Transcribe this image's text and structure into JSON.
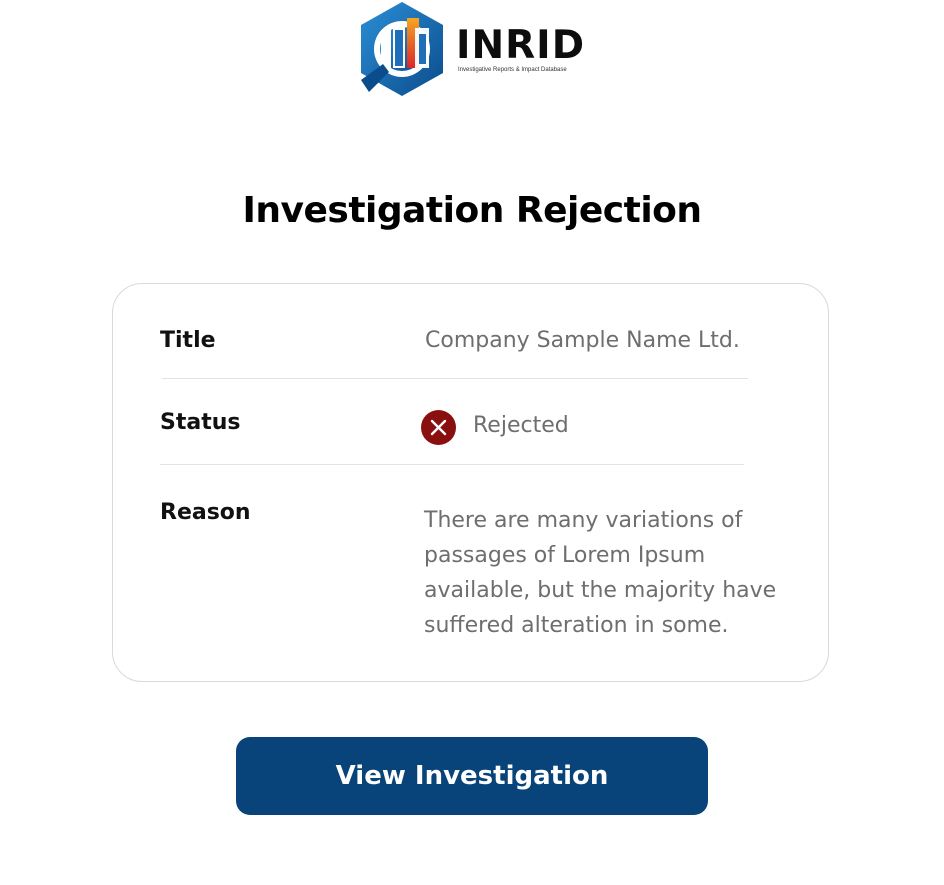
{
  "logo": {
    "wordmark": "INRID",
    "tagline": "Investigative Reports & Impact Database"
  },
  "header": {
    "title": "Investigation Rejection"
  },
  "details": {
    "title_label": "Title",
    "title_value": "Company Sample Name Ltd.",
    "status_label": "Status",
    "status_value": "Rejected",
    "status_icon": "x-circle-icon",
    "reason_label": "Reason",
    "reason_value": "There are many variations of passages of Lorem Ipsum available, but the majority have suffered alteration in some."
  },
  "actions": {
    "view_label": "View Investigation"
  },
  "colors": {
    "primary": "#08447a",
    "rejected": "#8a0f0f",
    "logo_blue": "#1f6fb8",
    "logo_red": "#e0312b"
  }
}
